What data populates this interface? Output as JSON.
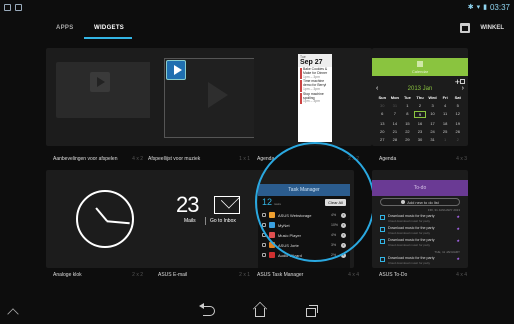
{
  "status": {
    "time": "03:37"
  },
  "tabs": {
    "apps": "APPS",
    "widgets": "WIDGETS",
    "store": "WINKEL"
  },
  "widgets": [
    {
      "name": "Aanbevelingen voor afspelen",
      "size": "4 x 2"
    },
    {
      "name": "Afspeellijst voor muziek",
      "size": "1 x 1"
    },
    {
      "name": "Agenda",
      "size": "2 x 2"
    },
    {
      "name": "Agenda",
      "size": "4 x 3"
    },
    {
      "name": "Analoge klok",
      "size": "2 x 2"
    },
    {
      "name": "ASUS E-mail",
      "size": "2 x 1"
    },
    {
      "name": "ASUS Task Manager",
      "size": "4 x 4"
    },
    {
      "name": "ASUS To-Do",
      "size": "4 x 4"
    }
  ],
  "agenda_small": {
    "weekday": "Tue",
    "date": "Sep 27",
    "events": [
      {
        "title": "Bake Cookies & Make for Dinner",
        "time": "1pm – 3pm"
      },
      {
        "title": "Time machine demo for Berryl",
        "time": "1pm – 3pm"
      },
      {
        "title": "Stop machine spoiling",
        "time": "1pm – 3pm"
      }
    ]
  },
  "agenda_big": {
    "header": "Calendar",
    "month": "2013 Jan",
    "weekdays": [
      "Sun",
      "Mon",
      "Tue",
      "Thu",
      "Wed",
      "Fri",
      "Sat"
    ],
    "days": [
      [
        "30",
        "31",
        "1",
        "2",
        "3",
        "4",
        "5"
      ],
      [
        "6",
        "7",
        "8",
        "9",
        "10",
        "11",
        "12"
      ],
      [
        "13",
        "14",
        "15",
        "16",
        "17",
        "18",
        "19"
      ],
      [
        "20",
        "21",
        "22",
        "23",
        "24",
        "25",
        "26"
      ],
      [
        "27",
        "28",
        "29",
        "30",
        "31",
        "1",
        "2"
      ]
    ],
    "today": "9"
  },
  "email": {
    "count": "23",
    "mails": "Mails",
    "go_to": "Go to Inbox"
  },
  "task_manager": {
    "title": "Task Manager",
    "count": "12",
    "count_label": "tasks",
    "clear_all": "Clear All",
    "rows": [
      {
        "name": "ASUS Webstorage",
        "pct": "4%",
        "color": "#f0a030"
      },
      {
        "name": "MyNet",
        "pct": "10%",
        "color": "#3aa0e0"
      },
      {
        "name": "Music Player",
        "pct": "4%",
        "color": "#e05050"
      },
      {
        "name": "ASUS Jorte",
        "pct": "3%",
        "color": "#e08020"
      },
      {
        "name": "Audio Wizard",
        "pct": "2%",
        "color": "#d03030"
      }
    ]
  },
  "todo": {
    "header": "To-do",
    "add_label": "Add new to do list",
    "date1": "FRI, 31 JANUARY 2013",
    "date2": "TUE, 11 JANUARY",
    "items": [
      {
        "title": "Download music for the party",
        "sub": "Cloud download music for party"
      },
      {
        "title": "Download music for the party",
        "sub": "Cloud download music for party"
      },
      {
        "title": "Download music for the party",
        "sub": "Cloud download music for party"
      },
      {
        "title": "Download music for the party",
        "sub": "Cloud download music for party"
      },
      {
        "title": "Download music for the party",
        "sub": "Cloud download music for party"
      }
    ]
  }
}
